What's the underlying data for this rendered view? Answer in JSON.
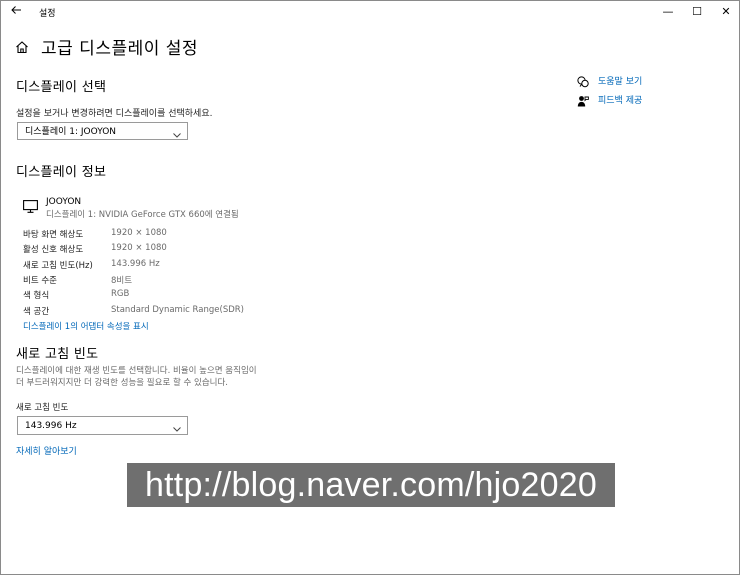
{
  "window": {
    "title": "설정",
    "back_icon": "back-arrow-icon",
    "min_glyph": "—",
    "max_glyph": "☐",
    "close_glyph": "✕"
  },
  "page": {
    "title": "고급 디스플레이 설정"
  },
  "select_display": {
    "heading": "디스플레이 선택",
    "description": "설정을 보거나 변경하려면 디스플레이를 선택하세요.",
    "selected": "디스플레이 1: JOOYON"
  },
  "display_info": {
    "heading": "디스플레이 정보",
    "monitor_name": "JOOYON",
    "monitor_desc": "디스플레이 1: NVIDIA GeForce GTX 660에 연결됨",
    "rows": [
      {
        "label": "바탕 화면 해상도",
        "value": "1920 × 1080"
      },
      {
        "label": "활성 신호 해상도",
        "value": "1920 × 1080"
      },
      {
        "label": "새로 고침 빈도(Hz)",
        "value": "143.996 Hz"
      },
      {
        "label": "비트 수준",
        "value": "8비트"
      },
      {
        "label": "색 형식",
        "value": "RGB"
      },
      {
        "label": "색 공간",
        "value": "Standard Dynamic Range(SDR)"
      }
    ],
    "adapter_link": "디스플레이 1의 어댑터 속성을 표시"
  },
  "refresh_rate": {
    "heading": "새로 고침 빈도",
    "description_line1": "디스플레이에 대한 재생 빈도를 선택합니다. 비율이 높으면 움직임이",
    "description_line2": "더 부드러워지지만 더 강력한 성능을 필요로 할 수 있습니다.",
    "field_label": "새로 고침 빈도",
    "selected": "143.996 Hz",
    "learn_more": "자세히 알아보기"
  },
  "side": {
    "help_label": "도움말 보기",
    "feedback_label": "피드백 제공"
  },
  "watermark": {
    "text": "http://blog.naver.com/hjo2020"
  },
  "colors": {
    "accent": "#0067b8",
    "watermark_bg": "#6f6f6f"
  }
}
